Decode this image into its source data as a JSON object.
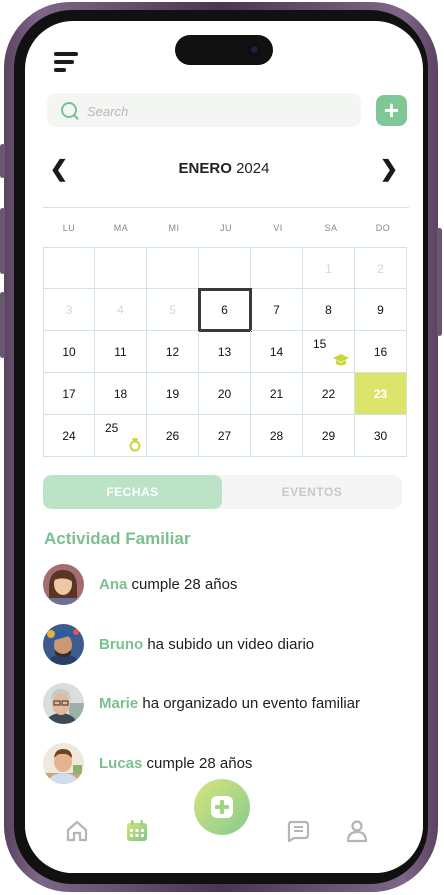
{
  "search": {
    "placeholder": "Search"
  },
  "calendar": {
    "month": "ENERO",
    "year": "2024",
    "weekdays": [
      "LU",
      "MA",
      "MI",
      "JU",
      "VI",
      "SA",
      "DO"
    ],
    "days": {
      "d1": "1",
      "d2": "2",
      "d3": "3",
      "d4": "4",
      "d5": "5",
      "d6": "6",
      "d7": "7",
      "d8": "8",
      "d9": "9",
      "d10": "10",
      "d11": "11",
      "d12": "12",
      "d13": "13",
      "d14": "14",
      "d15": "15",
      "d16": "16",
      "d17": "17",
      "d18": "18",
      "d19": "19",
      "d20": "20",
      "d21": "21",
      "d22": "22",
      "d23": "23",
      "d24": "24",
      "d25": "25",
      "d26": "26",
      "d27": "27",
      "d28": "28",
      "d29": "29",
      "d30": "30"
    },
    "today": 6,
    "selected": 23,
    "event_icons": {
      "d15": "graduation-cap-icon",
      "d25": "ring-icon"
    }
  },
  "tabs": {
    "active": "FECHAS",
    "inactive": "EVENTOS"
  },
  "activity": {
    "title": "Actividad Familiar",
    "items": [
      {
        "name": "Ana",
        "text": "cumple 28 años"
      },
      {
        "name": "Bruno",
        "text": "ha subido un video diario"
      },
      {
        "name": "Marie",
        "text": "ha organizado un evento familiar"
      },
      {
        "name": "Lucas",
        "text": "cumple 28 años"
      }
    ]
  },
  "nav": {
    "items": [
      "home-icon",
      "calendar-icon",
      "add-icon",
      "chat-icon",
      "profile-icon"
    ],
    "active": "calendar-icon"
  },
  "colors": {
    "accent": "#7cc08f",
    "highlight": "#dde46c",
    "tab_active": "#bde3c7"
  }
}
